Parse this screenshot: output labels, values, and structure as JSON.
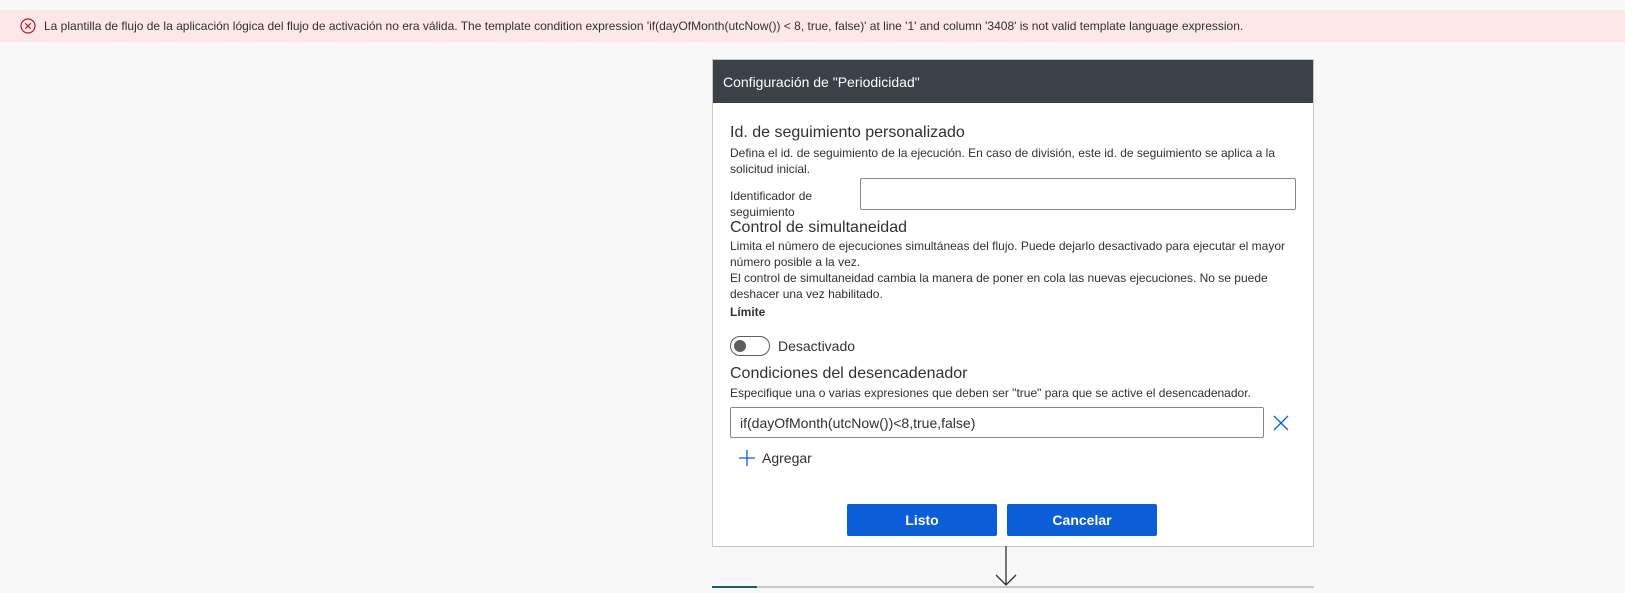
{
  "error": {
    "message": "La plantilla de flujo de la aplicación lógica del flujo de activación no era válida. The template condition expression 'if(dayOfMonth(utcNow()) < 8, true, false)' at line '1' and column '3408' is not valid template language expression.",
    "icon": "error-circle-icon",
    "color": "#fde7e9"
  },
  "panel": {
    "title": "Configuración de \"Periodicidad\"",
    "tracking": {
      "title": "Id. de seguimiento personalizado",
      "description": "Defina el id. de seguimiento de la ejecución. En caso de división, este id. de seguimiento se aplica a la solicitud inicial.",
      "label": "Identificador de seguimiento",
      "value": ""
    },
    "concurrency": {
      "title": "Control de simultaneidad",
      "description1": "Limita el número de ejecuciones simultáneas del flujo. Puede dejarlo desactivado para ejecutar el mayor número posible a la vez.",
      "description2": "El control de simultaneidad cambia la manera de poner en cola las nuevas ejecuciones. No se puede deshacer una vez habilitado.",
      "limit_label": "Límite",
      "toggle_label": "Desactivado",
      "toggle_on": false
    },
    "trigger": {
      "title": "Condiciones del desencadenador",
      "description": "Especifique una o varias expresiones que deben ser \"true\" para que se active el desencadenador.",
      "expression": "if(dayOfMonth(utcNow())<8,true,false)",
      "add_label": "Agregar"
    },
    "buttons": {
      "done": "Listo",
      "cancel": "Cancelar"
    }
  },
  "colors": {
    "header": "#3b4149",
    "primary": "#0b5ed7",
    "error_text": "#a4262c"
  }
}
